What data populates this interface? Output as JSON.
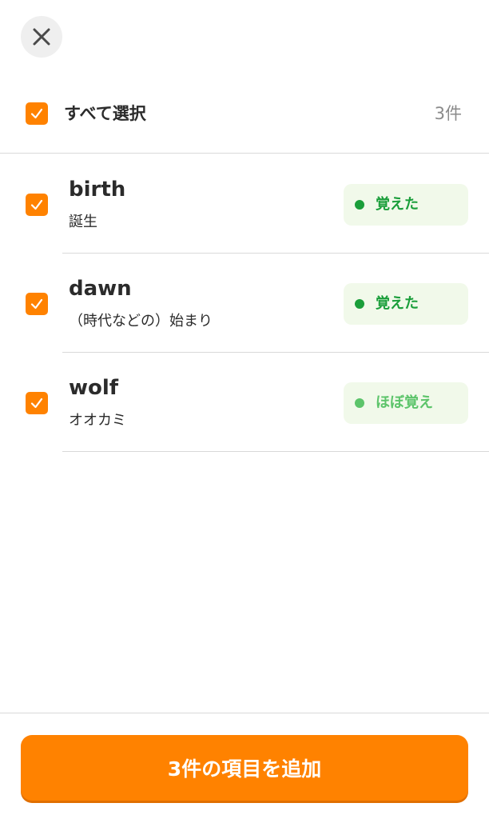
{
  "header": {
    "close_icon": "close-icon"
  },
  "select_all": {
    "label": "すべて選択",
    "count": "3件",
    "checked": true
  },
  "words": [
    {
      "term": "birth",
      "meaning": "誕生",
      "status": "覚えた",
      "status_color": "#1a9e3a",
      "dot_color": "#1a9e3a",
      "checked": true
    },
    {
      "term": "dawn",
      "meaning": "（時代などの）始まり",
      "status": "覚えた",
      "status_color": "#1a9e3a",
      "dot_color": "#1a9e3a",
      "checked": true
    },
    {
      "term": "wolf",
      "meaning": "オオカミ",
      "status": "ほぼ覚え",
      "status_color": "#5cc46a",
      "dot_color": "#5cc46a",
      "checked": true
    }
  ],
  "footer": {
    "add_button_label": "3件の項目を追加"
  },
  "colors": {
    "accent": "#ff8200",
    "badge_bg": "#f1f9ea"
  }
}
